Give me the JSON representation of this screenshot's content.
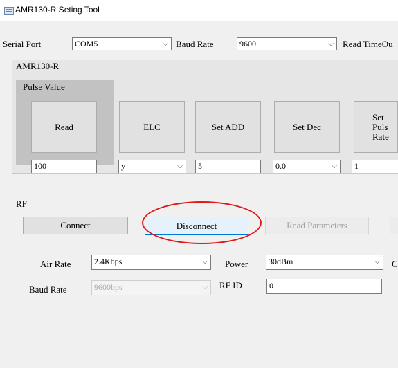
{
  "window": {
    "title": "AMR130-R Seting Tool"
  },
  "serial": {
    "port_label": "Serial Port",
    "port_value": "COM5",
    "baud_label": "Baud Rate",
    "baud_value": "9600",
    "timeout_label": "Read TimeOu"
  },
  "amr_group": {
    "title": "AMR130-R",
    "pulse_title": "Pulse Value",
    "read_label": "Read",
    "read_value": "100",
    "elc_label": "ELC",
    "elc_value": "y",
    "set_add_label": "Set ADD",
    "set_add_value": "5",
    "set_dec_label": "Set Dec",
    "set_dec_value": "0.0",
    "set_pulse_label": "Set Puls Rate",
    "set_pulse_value": "1"
  },
  "rf": {
    "title": "RF",
    "connect_label": "Connect",
    "disconnect_label": "Disconnect",
    "read_params_label": "Read Parameters",
    "air_rate_label": "Air Rate",
    "air_rate_value": "2.4Kbps",
    "power_label": "Power",
    "power_value": "30dBm",
    "baud_label": "Baud Rate",
    "baud_value": "9600bps",
    "rf_id_label": "RF  ID",
    "rf_id_value": "0",
    "cut_label": "C"
  },
  "colors": {
    "highlight_ring": "#e01818",
    "focus_border": "#0078d7"
  },
  "icons": {
    "app": "app-icon",
    "dropdown": "chevron-down-icon"
  }
}
